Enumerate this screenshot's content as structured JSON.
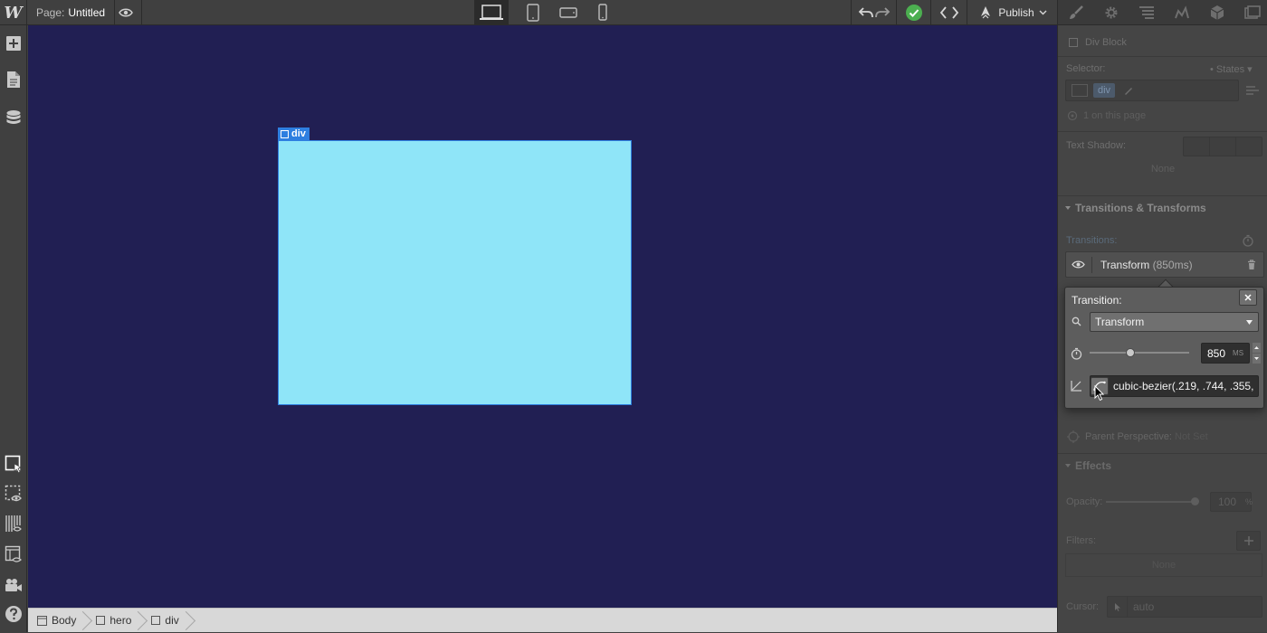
{
  "topbar": {
    "logo": "W",
    "page_label": "Page:",
    "page_name": "Untitled",
    "publish_label": "Publish"
  },
  "canvas": {
    "element_tag": "div"
  },
  "breadcrumb": [
    "Body",
    "hero",
    "div"
  ],
  "panel": {
    "element_type": "Div Block",
    "selector_label": "Selector:",
    "states_label": "States",
    "selector_tag": "div",
    "on_page": "1 on this page",
    "text_shadow_label": "Text Shadow:",
    "text_shadow_value": "None",
    "transitions_section": "Transitions & Transforms",
    "transitions_label": "Transitions:",
    "transition_item": "Transform",
    "transition_item_duration": "(850ms)",
    "popover": {
      "title": "Transition:",
      "property": "Transform",
      "duration_value": "850",
      "duration_unit": "MS",
      "duration_slider_fraction": 0.4,
      "easing": "cubic-bezier(.219, .744, .355,"
    },
    "parent_perspective_label": "Parent Perspective:",
    "parent_perspective_value": "Not Set",
    "effects_section": "Effects",
    "opacity_label": "Opacity:",
    "opacity_value": "100",
    "opacity_unit": "%",
    "filters_label": "Filters:",
    "filters_value": "None",
    "cursor_label": "Cursor:",
    "cursor_value": "auto"
  },
  "colors": {
    "canvas_bg": "#211f53",
    "selected_div": "#8fe5f8",
    "selection_blue": "#2e7fe0",
    "check_green": "#4caf50"
  }
}
